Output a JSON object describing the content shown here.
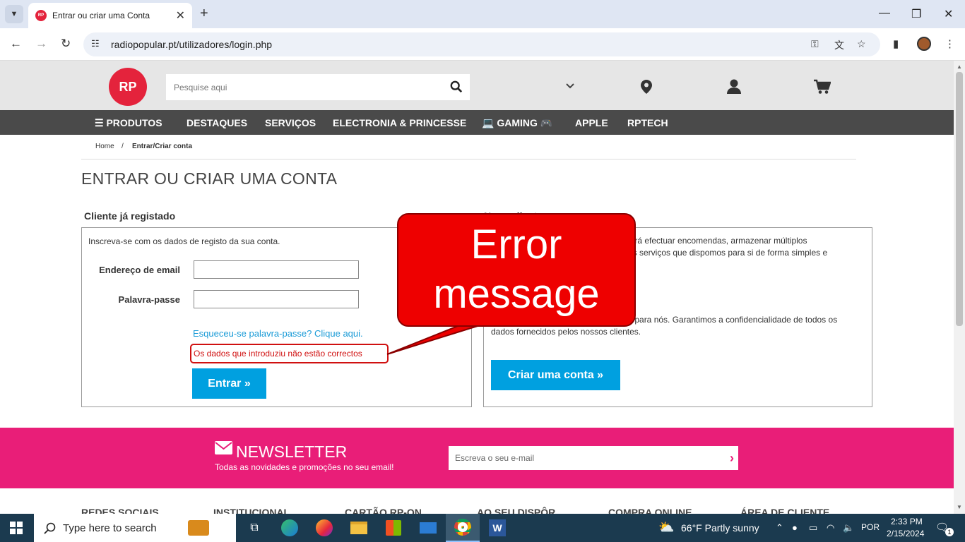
{
  "browser": {
    "tab_title": "Entrar ou criar uma Conta",
    "url": "radiopopular.pt/utilizadores/login.php",
    "favicon_text": "RP"
  },
  "site": {
    "logo_text": "RP",
    "search_placeholder": "Pesquise aqui",
    "menu": [
      "PRODUTOS",
      "DESTAQUES",
      "SERVIÇOS",
      "ELECTRONIA & PRINCESSE",
      "GAMING",
      "APPLE",
      "RPTECH"
    ],
    "breadcrumb": {
      "home": "Home",
      "separator": "/",
      "current": "Entrar/Criar conta"
    },
    "page_title": "ENTRAR OU CRIAR UMA CONTA"
  },
  "login": {
    "section_title": "Cliente já registado",
    "intro": "Inscreva-se com os dados de registo da sua conta.",
    "email_label": "Endereço de email",
    "password_label": "Palavra-passe",
    "forgot_link": "Esqueceu-se palavra-passe? Clique aqui.",
    "error_text": "Os dados que introduziu não estão correctos",
    "submit_label": "Entrar »"
  },
  "register": {
    "section_title": "Novo cliente",
    "text1_line1": "derá efectuar encomendas, armazenar múltiplos",
    "text1_line2": "ros serviços que dispomos para si de forma simples e",
    "text2_line1": "te para nós. Garantimos a confidencialidade de todos os",
    "text2_line2": "dados fornecidos pelos nossos clientes.",
    "button_label": "Criar uma conta »"
  },
  "newsletter": {
    "title": "NEWSLETTER",
    "subtitle": "Todas as novidades e promoções no seu email!",
    "placeholder": "Escreva o seu e-mail"
  },
  "footer_columns": [
    "REDES SOCIAIS",
    "INSTITUCIONAL",
    "CARTÃO RP-ON",
    "AO SEU DISPÔR",
    "COMPRA ONLINE",
    "ÁREA DE CLIENTE"
  ],
  "annotation": {
    "line1": "Error",
    "line2": "message"
  },
  "taskbar": {
    "search_placeholder": "Type here to search",
    "weather": "66°F  Partly sunny",
    "lang": "POR",
    "time": "2:33 PM",
    "date": "2/15/2024",
    "notif_count": "1"
  },
  "colors": {
    "brand_red": "#e4233c",
    "accent_blue": "#00a0e0",
    "newsletter_pink": "#e91e78",
    "error_red": "#d01010"
  }
}
